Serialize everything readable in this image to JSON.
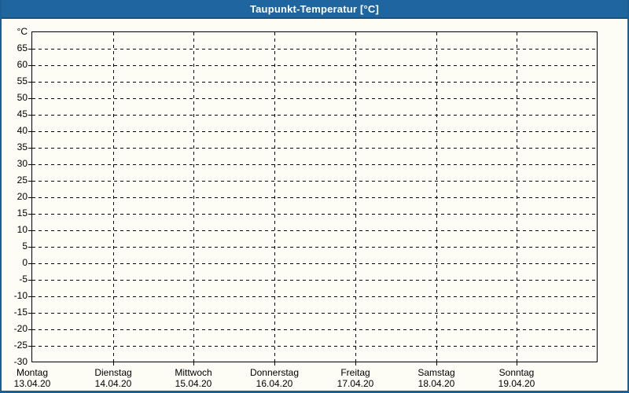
{
  "window": {
    "title": "Taupunkt-Temperatur [°C]"
  },
  "colors": {
    "header_bg": "#1f66a0",
    "header_border": "#155280",
    "frame_border": "#1d5f94",
    "background": "#fdfdf6",
    "grid": "#000000",
    "text": "#000000",
    "title_text": "#ffffff"
  },
  "chart_data": {
    "type": "line",
    "title": "Taupunkt-Temperatur [°C]",
    "ylabel": "°C",
    "ylim": [
      -30,
      70
    ],
    "ytick_step": 5,
    "yticks": [
      {
        "value": 70,
        "label": "°C"
      },
      {
        "value": 65,
        "label": "65"
      },
      {
        "value": 60,
        "label": "60"
      },
      {
        "value": 55,
        "label": "55"
      },
      {
        "value": 50,
        "label": "50"
      },
      {
        "value": 45,
        "label": "45"
      },
      {
        "value": 40,
        "label": "40"
      },
      {
        "value": 35,
        "label": "35"
      },
      {
        "value": 30,
        "label": "30"
      },
      {
        "value": 25,
        "label": "25"
      },
      {
        "value": 20,
        "label": "20"
      },
      {
        "value": 15,
        "label": "15"
      },
      {
        "value": 10,
        "label": "10"
      },
      {
        "value": 5,
        "label": "5"
      },
      {
        "value": 0,
        "label": "0"
      },
      {
        "value": -5,
        "label": "-5"
      },
      {
        "value": -10,
        "label": "-10"
      },
      {
        "value": -15,
        "label": "-15"
      },
      {
        "value": -20,
        "label": "-20"
      },
      {
        "value": -25,
        "label": "-25"
      },
      {
        "value": -30,
        "label": "-30"
      }
    ],
    "x_categories": [
      {
        "day": "Montag",
        "date": "13.04.20"
      },
      {
        "day": "Dienstag",
        "date": "14.04.20"
      },
      {
        "day": "Mittwoch",
        "date": "15.04.20"
      },
      {
        "day": "Donnerstag",
        "date": "16.04.20"
      },
      {
        "day": "Freitag",
        "date": "17.04.20"
      },
      {
        "day": "Samstag",
        "date": "18.04.20"
      },
      {
        "day": "Sonntag",
        "date": "19.04.20"
      }
    ],
    "series": [],
    "grid": "dashed",
    "legend": "none"
  }
}
